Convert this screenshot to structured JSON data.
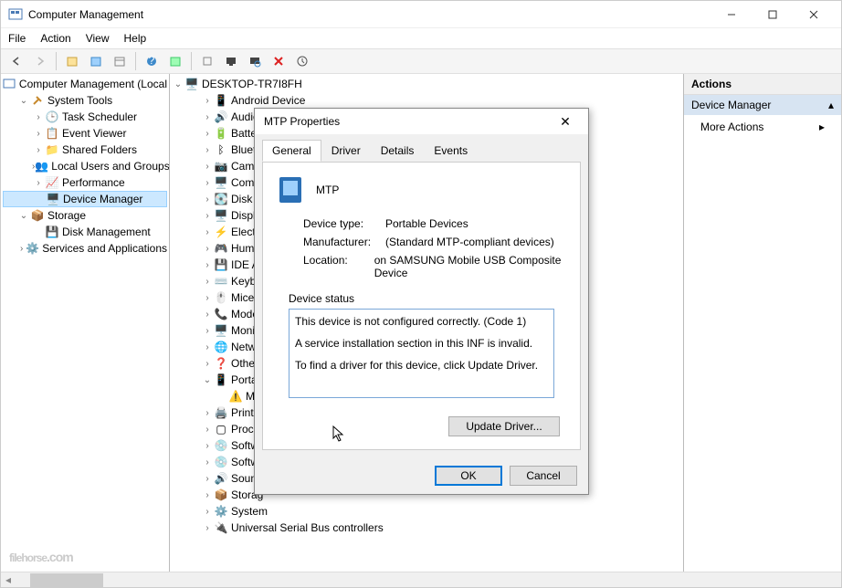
{
  "titlebar": {
    "title": "Computer Management"
  },
  "menubar": [
    "File",
    "Action",
    "View",
    "Help"
  ],
  "left_tree": {
    "root": "Computer Management (Local",
    "system_tools": "System Tools",
    "st_items": [
      "Task Scheduler",
      "Event Viewer",
      "Shared Folders",
      "Local Users and Groups",
      "Performance",
      "Device Manager"
    ],
    "storage": "Storage",
    "storage_items": [
      "Disk Management"
    ],
    "services": "Services and Applications"
  },
  "mid_tree": {
    "root": "DESKTOP-TR7I8FH",
    "categories": [
      "Android Device",
      "Audio i",
      "Batteri",
      "Bluetoo",
      "Camera",
      "Compu",
      "Disk dri",
      "Display",
      "Electro",
      "Human",
      "IDE ATA",
      "Keyboa",
      "Mice a",
      "Moder",
      "Monito",
      "Netwo",
      "Other d",
      "Porta",
      "MT",
      "Print qu",
      "Proces",
      "Softwa",
      "Softwa",
      "Sound,",
      "Storag",
      "System",
      "Universal Serial Bus controllers"
    ]
  },
  "right_pane": {
    "header": "Actions",
    "group": "Device Manager",
    "item": "More Actions"
  },
  "dialog": {
    "title": "MTP Properties",
    "tabs": [
      "General",
      "Driver",
      "Details",
      "Events"
    ],
    "device_name": "MTP",
    "rows": {
      "device_type_label": "Device type:",
      "device_type_value": "Portable Devices",
      "manufacturer_label": "Manufacturer:",
      "manufacturer_value": "(Standard MTP-compliant devices)",
      "location_label": "Location:",
      "location_value": "on SAMSUNG Mobile USB Composite Device"
    },
    "status_label": "Device status",
    "status_lines": [
      "This device is not configured correctly. (Code 1)",
      "A service installation section in this INF is invalid.",
      "To find a driver for this device, click Update Driver."
    ],
    "update_driver": "Update Driver...",
    "ok": "OK",
    "cancel": "Cancel"
  },
  "watermark": "filehorse",
  "watermark_suffix": ".com"
}
